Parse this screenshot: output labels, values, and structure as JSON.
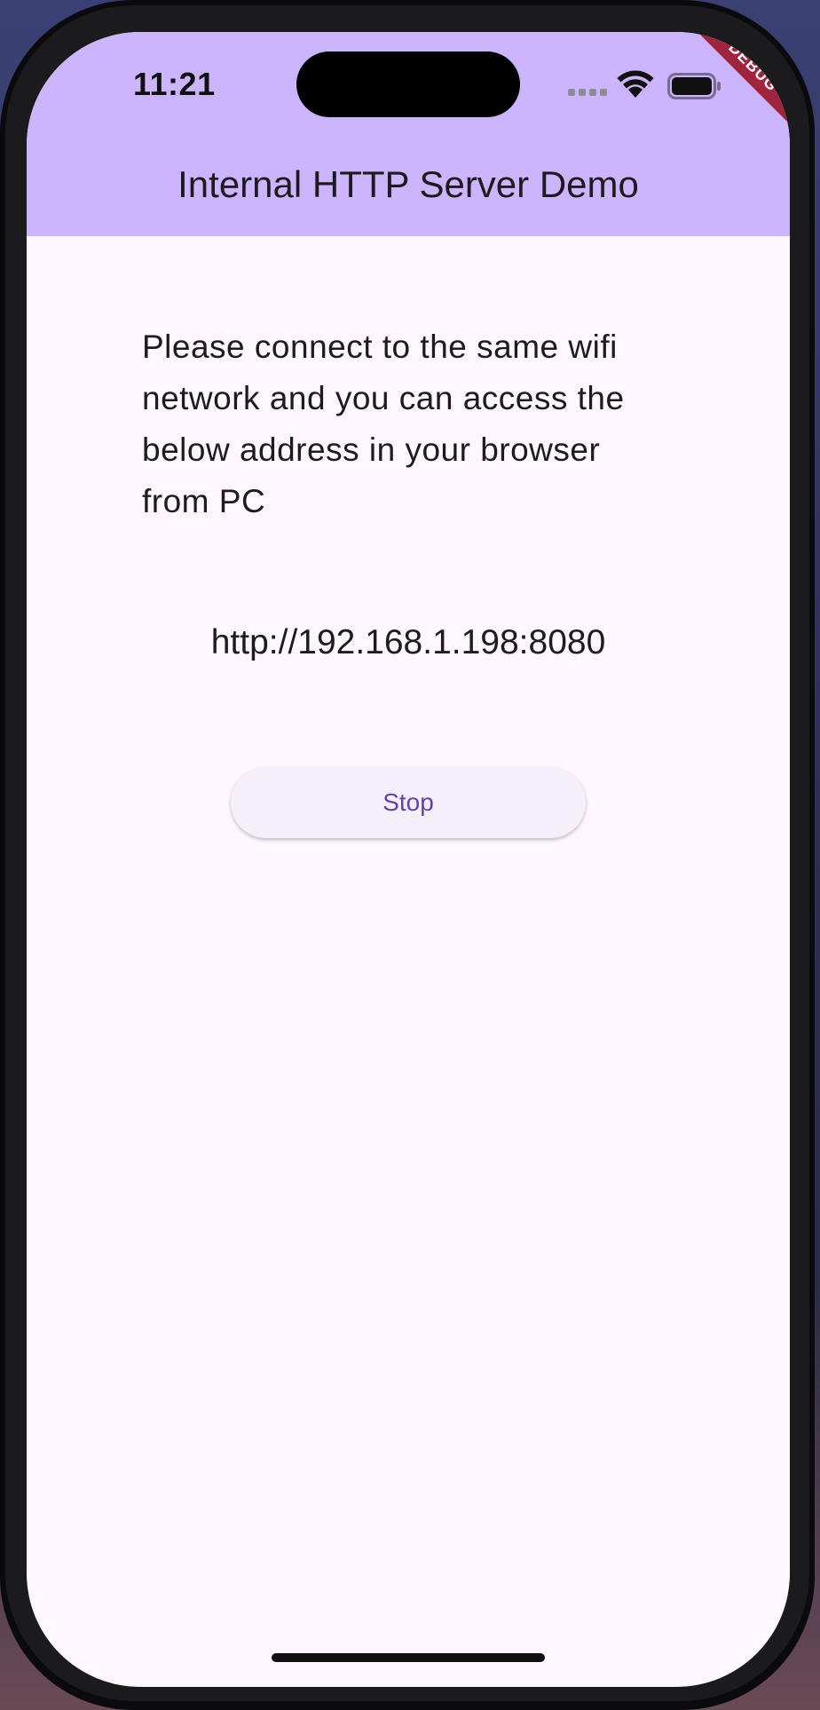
{
  "status_bar": {
    "time": "11:21",
    "signal_icon": "cellular-signal-icon",
    "wifi_icon": "wifi-icon",
    "battery_icon": "battery-icon"
  },
  "debug_banner": "DEBUG",
  "app_bar": {
    "title": "Internal HTTP Server Demo",
    "color": "#cdb5fe"
  },
  "body": {
    "instructions": "Please connect to the same wifi network and you can access the below address in your browser from PC",
    "server_address": "http://192.168.1.198:8080",
    "stop_button_label": "Stop",
    "accent_color": "#6442ad",
    "background": "#fef7ff"
  }
}
